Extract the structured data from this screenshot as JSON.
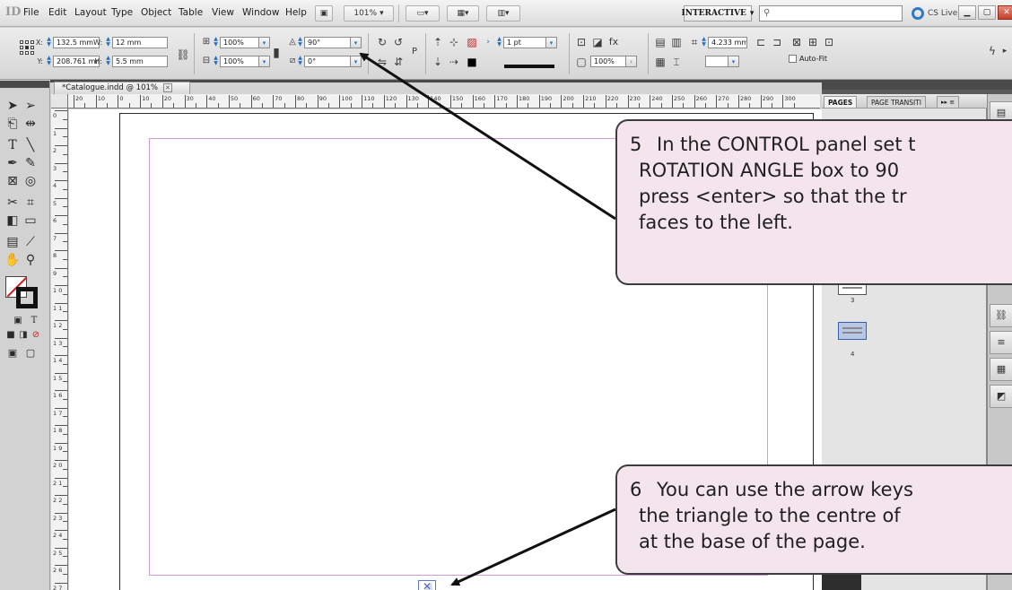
{
  "app": {
    "logo": "ID",
    "menus": [
      "File",
      "Edit",
      "Layout",
      "Type",
      "Object",
      "Table",
      "View",
      "Window",
      "Help"
    ],
    "zoom": "101%",
    "workspace": "INTERACTIVE",
    "search_placeholder": "",
    "cs_live": "CS Live"
  },
  "control_panel": {
    "x": "132.5 mm",
    "y": "208.761 mm",
    "w": "12 mm",
    "h": "5.5 mm",
    "scale_x": "100%",
    "scale_y": "100%",
    "rotation_angle": "90°",
    "shear_angle": "0°",
    "stroke_weight": "1 pt",
    "offset": "4.233 mm",
    "opacity": "100%",
    "auto_fit": "Auto-Fit"
  },
  "document": {
    "tab_title": "*Catalogue.indd @ 101%",
    "ruler_top": [
      "20",
      "10",
      "0",
      "10",
      "20",
      "30",
      "40",
      "50",
      "60",
      "70",
      "80",
      "90",
      "100",
      "110",
      "120",
      "130",
      "140",
      "150",
      "160",
      "170",
      "180",
      "190",
      "200",
      "210",
      "220",
      "230",
      "240",
      "250",
      "260",
      "270",
      "280",
      "290",
      "300"
    ],
    "ruler_left": [
      "0",
      "1",
      "2",
      "3",
      "4",
      "5",
      "6",
      "7",
      "8",
      "9",
      "1 0",
      "1 1",
      "1 2",
      "1 3",
      "1 4",
      "1 5",
      "1 6",
      "1 7",
      "1 8",
      "1 9",
      "2 0",
      "2 1",
      "2 2",
      "2 3",
      "2 4",
      "2 5",
      "2 6",
      "2 7"
    ]
  },
  "panels": {
    "tabs": [
      "PAGES",
      "PAGE TRANSITI"
    ],
    "page_numbers": [
      "3",
      "4"
    ]
  },
  "callouts": {
    "step5": {
      "number": "5",
      "lines": [
        "In the CONTROL panel set t",
        "ROTATION ANGLE box to 90",
        "press <enter> so that the tr",
        "faces to the left."
      ]
    },
    "step6": {
      "number": "6",
      "lines": [
        "You can use the arrow keys",
        "the triangle to the centre of",
        "at the base of the page."
      ]
    }
  },
  "colors": {
    "callout_fill": "#f4e5ec",
    "margin_guide": "#d59ad6",
    "selection": "#5b78c9"
  }
}
